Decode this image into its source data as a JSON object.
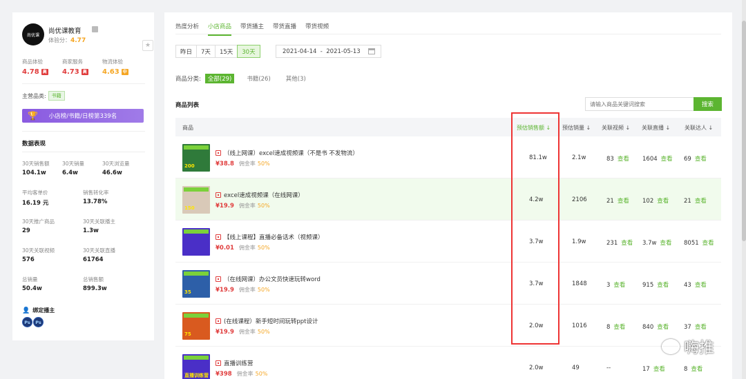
{
  "shop": {
    "logo_text": "尚优课",
    "name": "尚优课教育",
    "score_label": "体验分：",
    "score": "4.77",
    "star": "★",
    "experiences": [
      {
        "label": "商品体验",
        "value": "4.78",
        "tag": "高",
        "color": "#e03c3c"
      },
      {
        "label": "商家服务",
        "value": "4.73",
        "tag": "高",
        "color": "#e03c3c"
      },
      {
        "label": "物流体验",
        "value": "4.63",
        "tag": "中",
        "color": "#f5a623"
      }
    ],
    "main_category_label": "主营品类:",
    "main_category": "书籍",
    "rank_text": "小店榜/书籍/日榜第339名",
    "data_title": "数据表现",
    "stats": [
      {
        "label": "30天销售额",
        "value": "104.1w"
      },
      {
        "label": "30天销量",
        "value": "6.4w"
      },
      {
        "label": "30天浏览量",
        "value": "46.6w"
      },
      {
        "label": "平均客单价",
        "value": "16.19 元"
      },
      {
        "label": "销售转化率",
        "value": "13.78%"
      },
      {
        "label": "30天推广商品",
        "value": "29"
      },
      {
        "label": "30天关联播主",
        "value": "1.3w"
      },
      {
        "label": "30天关联视频",
        "value": "576"
      },
      {
        "label": "30天关联直播",
        "value": "61764"
      },
      {
        "label": "总销量",
        "value": "50.4w"
      },
      {
        "label": "总销售额",
        "value": "899.3w"
      }
    ],
    "bind_title": "绑定播主",
    "ps_icons": [
      "Ps",
      "Ps"
    ]
  },
  "tabs": [
    "热度分析",
    "小店商品",
    "带货播主",
    "带货直播",
    "带货视频"
  ],
  "active_tab": 1,
  "date_buttons": [
    "昨日",
    "7天",
    "15天",
    "30天"
  ],
  "active_date": 3,
  "date_range": "2021-04-14  -  2021-05-13",
  "category_label": "商品分类:",
  "categories": [
    "全部(29)",
    "书籍(26)",
    "其他(3)"
  ],
  "list_title": "商品列表",
  "search": {
    "placeholder": "请输入商品关键词搜索",
    "button": "搜索"
  },
  "columns": [
    "商品",
    "预估销售额 ↓",
    "预估销量 ↓",
    "关联视频 ↓",
    "关联直播 ↓",
    "关联达人 ↓"
  ],
  "look_label": "查看",
  "commission_label": "佣金率",
  "products": [
    {
      "name": "（线上网课）excel速成视频课（不是书 不发物流）",
      "price": "¥38.8",
      "commission": "50%",
      "sales_amount": "81.1w",
      "sales": "2.1w",
      "videos": "83",
      "lives": "1604",
      "talents": "69",
      "thumb_num": "200",
      "thumb_color": "#2f7a3a"
    },
    {
      "name": "excel速成视频课（在线网课）",
      "price": "¥19.9",
      "commission": "50%",
      "sales_amount": "4.2w",
      "sales": "2106",
      "videos": "21",
      "lives": "102",
      "talents": "21",
      "thumb_num": "150",
      "thumb_color": "#d9c9b8"
    },
    {
      "name": "【线上课程】直播必备话术（视频课）",
      "price": "¥0.01",
      "commission": "50%",
      "sales_amount": "3.7w",
      "sales": "1.9w",
      "videos": "231",
      "lives": "3.7w",
      "talents": "8051",
      "thumb_num": "",
      "thumb_color": "#4a2fc7"
    },
    {
      "name": "（在线网课）办公文员快速玩转word",
      "price": "¥19.9",
      "commission": "50%",
      "sales_amount": "3.7w",
      "sales": "1848",
      "videos": "3",
      "lives": "915",
      "talents": "43",
      "thumb_num": "35",
      "thumb_color": "#2d5fa8"
    },
    {
      "name": "(在线课程）新手短时间玩转ppt设计",
      "price": "¥19.9",
      "commission": "50%",
      "sales_amount": "2.0w",
      "sales": "1016",
      "videos": "8",
      "lives": "840",
      "talents": "37",
      "thumb_num": "75",
      "thumb_color": "#d95a1f"
    },
    {
      "name": "直播训练营",
      "price": "¥398",
      "commission": "50%",
      "sales_amount": "2.0w",
      "sales": "49",
      "videos": "--",
      "lives": "17",
      "talents": "8",
      "thumb_num": "直播训练营",
      "thumb_color": "#4a2fc7"
    }
  ],
  "watermark": "嗨推"
}
